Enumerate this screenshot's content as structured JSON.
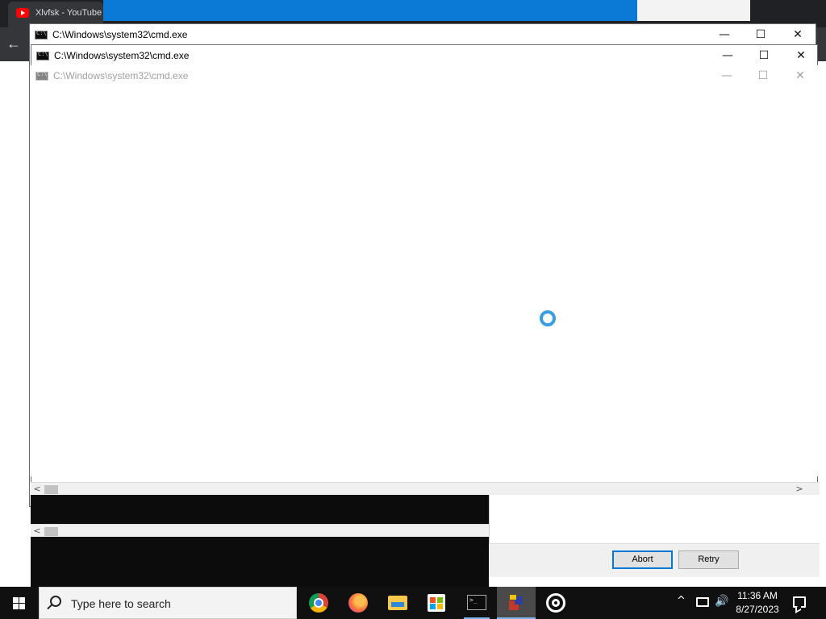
{
  "background_browser": {
    "tab_title": "Xlvfsk - YouTube",
    "back_arrow": "←"
  },
  "windows": [
    {
      "title": "C:\\Windows\\system32\\cmd.exe",
      "state": "active"
    },
    {
      "title": "C:\\Windows\\system32\\cmd.exe",
      "state": "active"
    },
    {
      "title": "C:\\Windows\\system32\\cmd.exe",
      "state": "inactive"
    }
  ],
  "window_controls": {
    "minimize": "—",
    "maximize": "☐",
    "close": "✕"
  },
  "scrollbar": {
    "left_arrow": "<",
    "right_arrow": ">"
  },
  "dialog": {
    "abort_label": "Abort",
    "retry_label": "Retry"
  },
  "taskbar": {
    "search_placeholder": "Type here to search",
    "apps": [
      "chrome-icon",
      "firefox-icon",
      "file-explorer-icon",
      "microsoft-store-icon",
      "cmd-icon",
      "package-icon",
      "target-icon"
    ],
    "tray": {
      "chevron": "^",
      "volume": "🔊",
      "time": "11:36 AM",
      "date": "8/27/2023"
    }
  },
  "colors": {
    "taskbar": "#101010",
    "accent": "#0078d7",
    "spinner": "#3b9de0",
    "console": "#0c0c0c"
  }
}
